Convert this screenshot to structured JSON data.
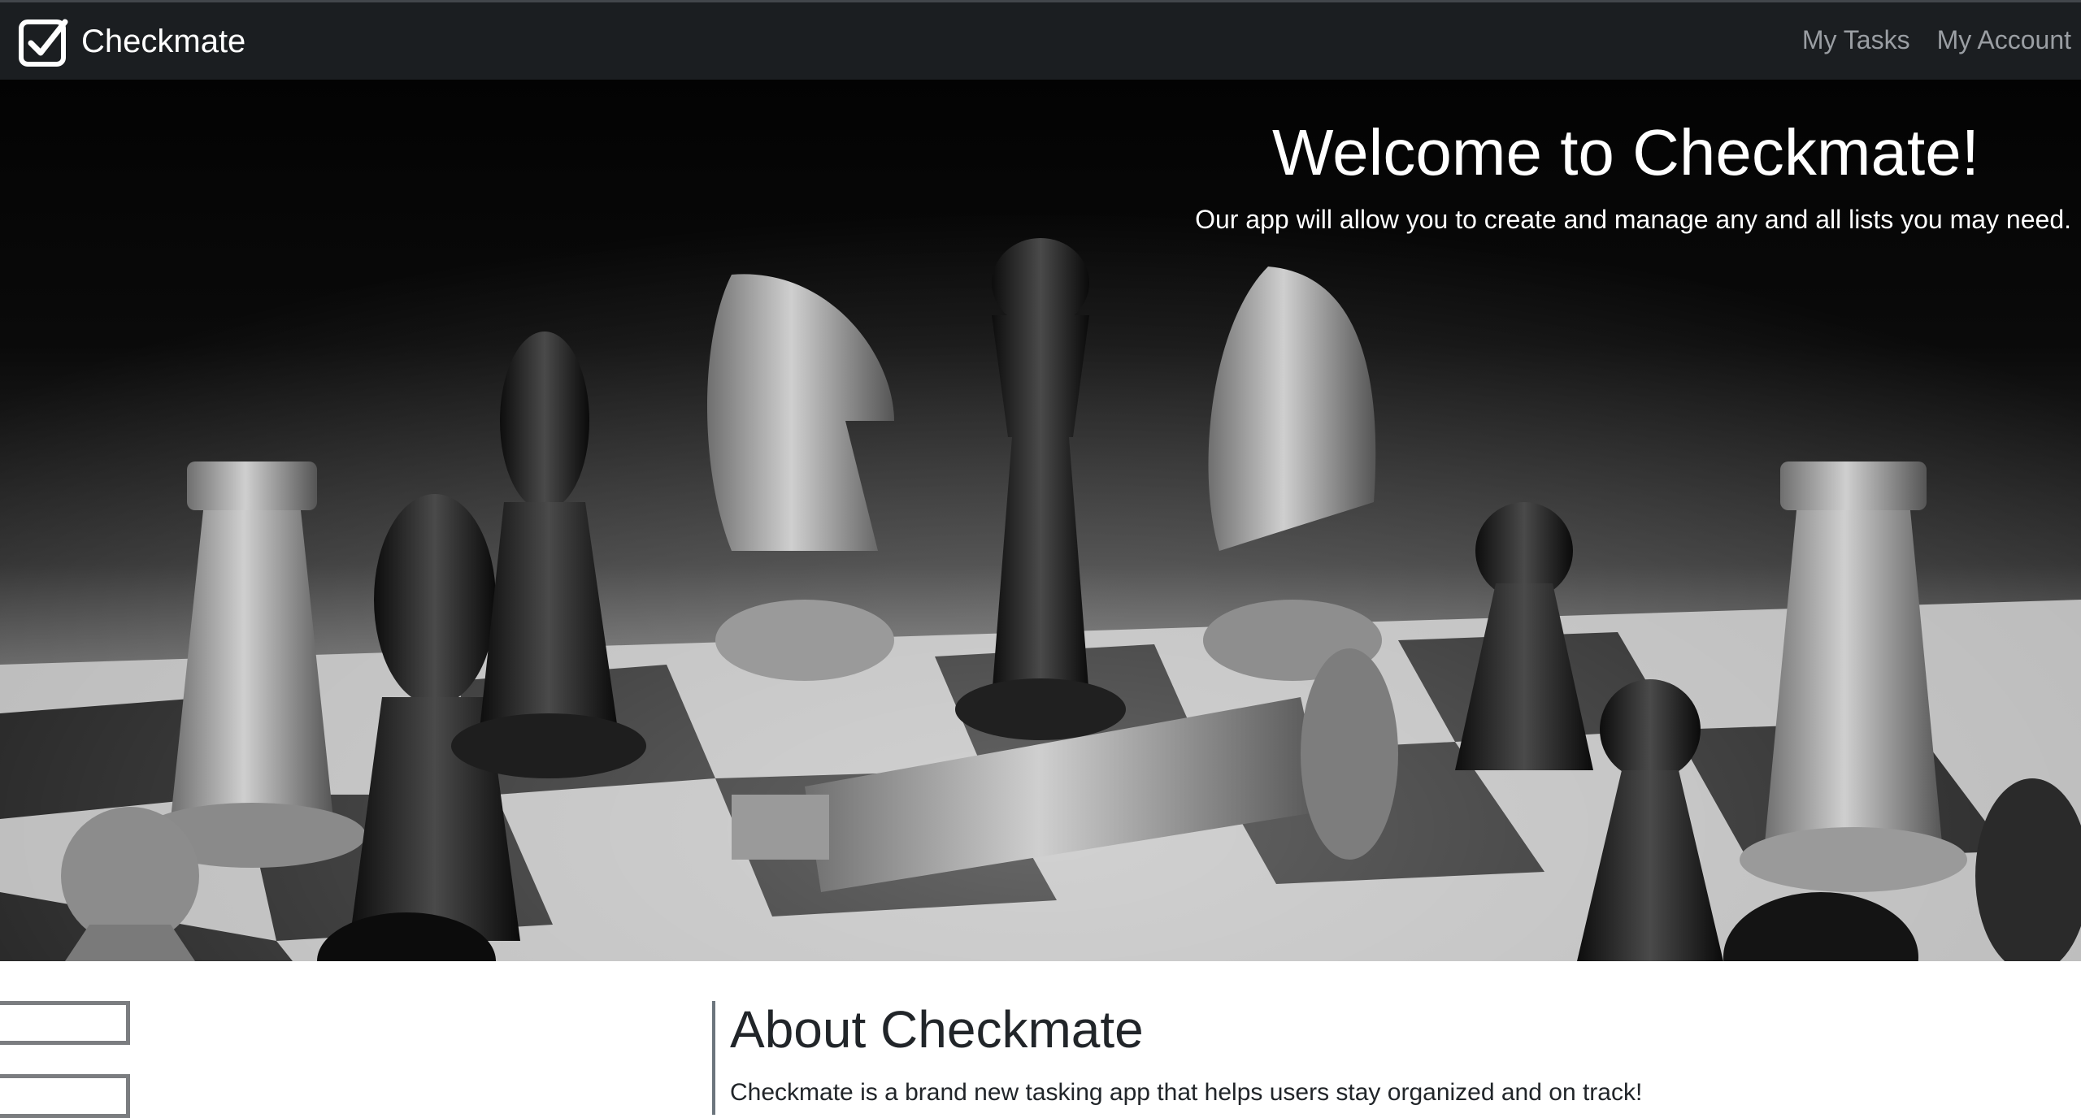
{
  "navbar": {
    "brand": "Checkmate",
    "links": [
      "My Tasks",
      "My Account"
    ]
  },
  "hero": {
    "title": "Welcome to Checkmate!",
    "subtitle": "Our app will allow you to create and manage any and all lists you may need.",
    "image_description": "black and white chessboard with fallen king"
  },
  "about": {
    "title": "About Checkmate",
    "text": "Checkmate is a brand new tasking app that helps users stay organized and on track!"
  },
  "icons": {
    "brand": "checkbox-check-icon"
  },
  "colors": {
    "navbar_bg": "#1b1e21",
    "nav_link": "#9a9ea3",
    "divider": "#6c757d"
  }
}
